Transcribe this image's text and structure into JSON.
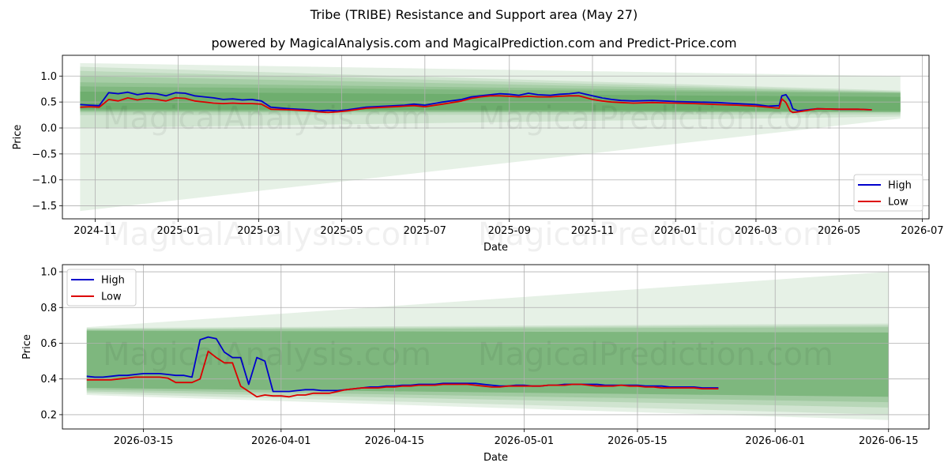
{
  "header": {
    "title": "Tribe (TRIBE) Resistance and Support area (May 27)",
    "subtitle": "powered by MagicalAnalysis.com and MagicalPrediction.com and Predict-Price.com"
  },
  "watermarks": [
    "MagicalAnalysis.com",
    "MagicalPrediction.com"
  ],
  "colors": {
    "high": "#0000cc",
    "low": "#dd0000",
    "band": "#2e8b2e",
    "grid": "#b0b0b0"
  },
  "chart_data": [
    {
      "type": "line",
      "xlabel": "Date",
      "ylabel": "Price",
      "xlim": [
        "2024-10-08",
        "2026-07-06"
      ],
      "ylim": [
        -1.75,
        1.4
      ],
      "x_ticks": [
        "2024-11-01",
        "2025-01-01",
        "2025-03-01",
        "2025-05-01",
        "2025-07-01",
        "2025-09-01",
        "2025-11-01",
        "2026-01-01",
        "2026-03-01",
        "2026-05-01",
        "2026-07-01"
      ],
      "x_tick_labels": [
        "2024-11",
        "2025-01",
        "2025-03",
        "2025-05",
        "2025-07",
        "2025-09",
        "2025-11",
        "2026-01",
        "2026-03",
        "2026-05",
        "2026-07"
      ],
      "y_ticks": [
        1.0,
        0.5,
        0.0,
        -0.5,
        -1.0,
        -1.5
      ],
      "y_tick_labels": [
        "1.0",
        "0.5",
        "0.0",
        "−0.5",
        "−1.0",
        "−1.5"
      ],
      "grid": true,
      "legend": {
        "position": "bottom-right",
        "entries": [
          "High",
          "Low"
        ]
      },
      "bands": {
        "x": [
          "2024-10-21",
          "2026-06-15"
        ],
        "layers": [
          {
            "lower": [
              -1.6,
              0.18
            ],
            "upper": [
              1.25,
              1.0
            ],
            "opacity": 0.12
          },
          {
            "lower": [
              0.0,
              0.22
            ],
            "upper": [
              1.18,
              0.72
            ],
            "opacity": 0.12
          },
          {
            "lower": [
              0.25,
              0.26
            ],
            "upper": [
              1.1,
              0.7
            ],
            "opacity": 0.12
          },
          {
            "lower": [
              0.3,
              0.3
            ],
            "upper": [
              1.0,
              0.69
            ],
            "opacity": 0.14
          },
          {
            "lower": [
              0.32,
              0.3
            ],
            "upper": [
              0.88,
              0.68
            ],
            "opacity": 0.16
          },
          {
            "lower": [
              0.34,
              0.31
            ],
            "upper": [
              0.8,
              0.67
            ],
            "opacity": 0.18
          },
          {
            "lower": [
              0.36,
              0.33
            ],
            "upper": [
              0.7,
              0.6
            ],
            "opacity": 0.22
          }
        ]
      },
      "series": [
        {
          "name": "High",
          "x": [
            "2024-10-21",
            "2024-10-28",
            "2024-11-04",
            "2024-11-11",
            "2024-11-18",
            "2024-11-25",
            "2024-12-02",
            "2024-12-09",
            "2024-12-16",
            "2024-12-23",
            "2024-12-30",
            "2025-01-06",
            "2025-01-13",
            "2025-01-20",
            "2025-01-27",
            "2025-02-03",
            "2025-02-10",
            "2025-02-17",
            "2025-02-24",
            "2025-03-03",
            "2025-03-10",
            "2025-03-24",
            "2025-04-07",
            "2025-04-14",
            "2025-04-21",
            "2025-04-28",
            "2025-05-05",
            "2025-05-19",
            "2025-06-02",
            "2025-06-16",
            "2025-06-23",
            "2025-07-01",
            "2025-07-14",
            "2025-07-28",
            "2025-08-04",
            "2025-08-11",
            "2025-08-18",
            "2025-08-25",
            "2025-09-01",
            "2025-09-08",
            "2025-09-15",
            "2025-09-22",
            "2025-10-01",
            "2025-10-08",
            "2025-10-15",
            "2025-10-22",
            "2025-11-01",
            "2025-11-08",
            "2025-11-15",
            "2025-11-22",
            "2025-12-01",
            "2025-12-15",
            "2026-01-01",
            "2026-01-15",
            "2026-02-01",
            "2026-02-15",
            "2026-03-01",
            "2026-03-10",
            "2026-03-18",
            "2026-03-20",
            "2026-03-23",
            "2026-03-26",
            "2026-03-28",
            "2026-04-01",
            "2026-04-15",
            "2026-05-01",
            "2026-05-15",
            "2026-05-25"
          ],
          "values": [
            0.45,
            0.44,
            0.43,
            0.68,
            0.66,
            0.69,
            0.64,
            0.67,
            0.66,
            0.62,
            0.68,
            0.67,
            0.62,
            0.6,
            0.58,
            0.55,
            0.56,
            0.54,
            0.55,
            0.52,
            0.4,
            0.37,
            0.35,
            0.33,
            0.34,
            0.33,
            0.35,
            0.4,
            0.42,
            0.44,
            0.46,
            0.44,
            0.5,
            0.55,
            0.6,
            0.62,
            0.64,
            0.66,
            0.65,
            0.63,
            0.67,
            0.64,
            0.63,
            0.65,
            0.66,
            0.68,
            0.62,
            0.58,
            0.55,
            0.53,
            0.52,
            0.53,
            0.51,
            0.5,
            0.49,
            0.47,
            0.45,
            0.42,
            0.43,
            0.62,
            0.64,
            0.52,
            0.37,
            0.33,
            0.37,
            0.36,
            0.36,
            0.35
          ]
        },
        {
          "name": "Low",
          "x": [
            "2024-10-21",
            "2024-10-28",
            "2024-11-04",
            "2024-11-11",
            "2024-11-18",
            "2024-11-25",
            "2024-12-02",
            "2024-12-09",
            "2024-12-16",
            "2024-12-23",
            "2024-12-30",
            "2025-01-06",
            "2025-01-13",
            "2025-01-20",
            "2025-01-27",
            "2025-02-03",
            "2025-02-10",
            "2025-02-17",
            "2025-02-24",
            "2025-03-03",
            "2025-03-10",
            "2025-03-24",
            "2025-04-07",
            "2025-04-14",
            "2025-04-21",
            "2025-04-28",
            "2025-05-05",
            "2025-05-19",
            "2025-06-02",
            "2025-06-16",
            "2025-06-23",
            "2025-07-01",
            "2025-07-14",
            "2025-07-28",
            "2025-08-04",
            "2025-08-11",
            "2025-08-18",
            "2025-08-25",
            "2025-09-01",
            "2025-09-08",
            "2025-09-15",
            "2025-09-22",
            "2025-10-01",
            "2025-10-08",
            "2025-10-15",
            "2025-10-22",
            "2025-11-01",
            "2025-11-08",
            "2025-11-15",
            "2025-11-22",
            "2025-12-01",
            "2025-12-15",
            "2026-01-01",
            "2026-01-15",
            "2026-02-01",
            "2026-02-15",
            "2026-03-01",
            "2026-03-10",
            "2026-03-18",
            "2026-03-20",
            "2026-03-23",
            "2026-03-26",
            "2026-03-28",
            "2026-04-01",
            "2026-04-15",
            "2026-05-01",
            "2026-05-15",
            "2026-05-25"
          ],
          "values": [
            0.4,
            0.41,
            0.4,
            0.55,
            0.52,
            0.58,
            0.54,
            0.57,
            0.55,
            0.52,
            0.58,
            0.57,
            0.52,
            0.5,
            0.48,
            0.47,
            0.48,
            0.47,
            0.47,
            0.46,
            0.36,
            0.35,
            0.33,
            0.31,
            0.3,
            0.31,
            0.33,
            0.38,
            0.4,
            0.42,
            0.43,
            0.41,
            0.46,
            0.52,
            0.57,
            0.6,
            0.62,
            0.62,
            0.61,
            0.6,
            0.61,
            0.6,
            0.6,
            0.61,
            0.62,
            0.62,
            0.55,
            0.52,
            0.5,
            0.49,
            0.48,
            0.49,
            0.48,
            0.47,
            0.45,
            0.44,
            0.42,
            0.4,
            0.38,
            0.56,
            0.49,
            0.33,
            0.3,
            0.31,
            0.37,
            0.36,
            0.36,
            0.35
          ]
        }
      ]
    },
    {
      "type": "line",
      "xlabel": "Date",
      "ylabel": "Price",
      "xlim": [
        "2026-03-05",
        "2026-06-20"
      ],
      "ylim": [
        0.12,
        1.04
      ],
      "x_ticks": [
        "2026-03-15",
        "2026-04-01",
        "2026-04-15",
        "2026-05-01",
        "2026-05-15",
        "2026-06-01",
        "2026-06-15"
      ],
      "x_tick_labels": [
        "2026-03-15",
        "2026-04-01",
        "2026-04-15",
        "2026-05-01",
        "2026-05-15",
        "2026-06-01",
        "2026-06-15"
      ],
      "y_ticks": [
        1.0,
        0.8,
        0.6,
        0.4,
        0.2
      ],
      "y_tick_labels": [
        "1.0",
        "0.8",
        "0.6",
        "0.4",
        "0.2"
      ],
      "grid": true,
      "legend": {
        "position": "top-left",
        "entries": [
          "High",
          "Low"
        ]
      },
      "bands": {
        "x": [
          "2026-03-08",
          "2026-06-15"
        ],
        "layers": [
          {
            "lower": [
              0.31,
              0.17
            ],
            "upper": [
              0.69,
              1.0
            ],
            "opacity": 0.12
          },
          {
            "lower": [
              0.32,
              0.2
            ],
            "upper": [
              0.685,
              0.71
            ],
            "opacity": 0.12
          },
          {
            "lower": [
              0.33,
              0.24
            ],
            "upper": [
              0.68,
              0.7
            ],
            "opacity": 0.14
          },
          {
            "lower": [
              0.34,
              0.27
            ],
            "upper": [
              0.675,
              0.69
            ],
            "opacity": 0.16
          },
          {
            "lower": [
              0.35,
              0.3
            ],
            "upper": [
              0.67,
              0.66
            ],
            "opacity": 0.3
          }
        ]
      },
      "series": [
        {
          "name": "High",
          "x": [
            "2026-03-08",
            "2026-03-09",
            "2026-03-10",
            "2026-03-11",
            "2026-03-12",
            "2026-03-13",
            "2026-03-14",
            "2026-03-15",
            "2026-03-16",
            "2026-03-17",
            "2026-03-18",
            "2026-03-19",
            "2026-03-20",
            "2026-03-21",
            "2026-03-22",
            "2026-03-23",
            "2026-03-24",
            "2026-03-25",
            "2026-03-26",
            "2026-03-27",
            "2026-03-28",
            "2026-03-29",
            "2026-03-30",
            "2026-03-31",
            "2026-04-01",
            "2026-04-02",
            "2026-04-03",
            "2026-04-04",
            "2026-04-05",
            "2026-04-06",
            "2026-04-07",
            "2026-04-08",
            "2026-04-09",
            "2026-04-10",
            "2026-04-11",
            "2026-04-12",
            "2026-04-13",
            "2026-04-14",
            "2026-04-15",
            "2026-04-16",
            "2026-04-17",
            "2026-04-18",
            "2026-04-19",
            "2026-04-20",
            "2026-04-21",
            "2026-04-22",
            "2026-04-23",
            "2026-04-24",
            "2026-04-25",
            "2026-04-26",
            "2026-04-27",
            "2026-04-28",
            "2026-04-29",
            "2026-04-30",
            "2026-05-01",
            "2026-05-02",
            "2026-05-03",
            "2026-05-04",
            "2026-05-05",
            "2026-05-06",
            "2026-05-07",
            "2026-05-08",
            "2026-05-09",
            "2026-05-10",
            "2026-05-11",
            "2026-05-12",
            "2026-05-13",
            "2026-05-14",
            "2026-05-15",
            "2026-05-16",
            "2026-05-17",
            "2026-05-18",
            "2026-05-19",
            "2026-05-20",
            "2026-05-21",
            "2026-05-22",
            "2026-05-23",
            "2026-05-24",
            "2026-05-25"
          ],
          "values": [
            0.415,
            0.41,
            0.41,
            0.415,
            0.42,
            0.42,
            0.425,
            0.43,
            0.43,
            0.43,
            0.425,
            0.42,
            0.42,
            0.41,
            0.62,
            0.635,
            0.625,
            0.55,
            0.52,
            0.52,
            0.37,
            0.52,
            0.5,
            0.33,
            0.33,
            0.33,
            0.335,
            0.34,
            0.34,
            0.335,
            0.335,
            0.335,
            0.34,
            0.345,
            0.35,
            0.355,
            0.355,
            0.36,
            0.36,
            0.365,
            0.365,
            0.37,
            0.37,
            0.37,
            0.375,
            0.375,
            0.375,
            0.375,
            0.375,
            0.37,
            0.365,
            0.36,
            0.36,
            0.365,
            0.365,
            0.36,
            0.36,
            0.365,
            0.365,
            0.37,
            0.37,
            0.37,
            0.37,
            0.37,
            0.365,
            0.365,
            0.365,
            0.365,
            0.365,
            0.36,
            0.36,
            0.36,
            0.355,
            0.355,
            0.355,
            0.355,
            0.35,
            0.35,
            0.35
          ]
        },
        {
          "name": "Low",
          "x": [
            "2026-03-08",
            "2026-03-09",
            "2026-03-10",
            "2026-03-11",
            "2026-03-12",
            "2026-03-13",
            "2026-03-14",
            "2026-03-15",
            "2026-03-16",
            "2026-03-17",
            "2026-03-18",
            "2026-03-19",
            "2026-03-20",
            "2026-03-21",
            "2026-03-22",
            "2026-03-23",
            "2026-03-24",
            "2026-03-25",
            "2026-03-26",
            "2026-03-27",
            "2026-03-28",
            "2026-03-29",
            "2026-03-30",
            "2026-03-31",
            "2026-04-01",
            "2026-04-02",
            "2026-04-03",
            "2026-04-04",
            "2026-04-05",
            "2026-04-06",
            "2026-04-07",
            "2026-04-08",
            "2026-04-09",
            "2026-04-10",
            "2026-04-11",
            "2026-04-12",
            "2026-04-13",
            "2026-04-14",
            "2026-04-15",
            "2026-04-16",
            "2026-04-17",
            "2026-04-18",
            "2026-04-19",
            "2026-04-20",
            "2026-04-21",
            "2026-04-22",
            "2026-04-23",
            "2026-04-24",
            "2026-04-25",
            "2026-04-26",
            "2026-04-27",
            "2026-04-28",
            "2026-04-29",
            "2026-04-30",
            "2026-05-01",
            "2026-05-02",
            "2026-05-03",
            "2026-05-04",
            "2026-05-05",
            "2026-05-06",
            "2026-05-07",
            "2026-05-08",
            "2026-05-09",
            "2026-05-10",
            "2026-05-11",
            "2026-05-12",
            "2026-05-13",
            "2026-05-14",
            "2026-05-15",
            "2026-05-16",
            "2026-05-17",
            "2026-05-18",
            "2026-05-19",
            "2026-05-20",
            "2026-05-21",
            "2026-05-22",
            "2026-05-23",
            "2026-05-24",
            "2026-05-25"
          ],
          "values": [
            0.395,
            0.395,
            0.395,
            0.395,
            0.4,
            0.405,
            0.41,
            0.41,
            0.41,
            0.41,
            0.405,
            0.38,
            0.38,
            0.38,
            0.4,
            0.555,
            0.52,
            0.49,
            0.49,
            0.36,
            0.33,
            0.3,
            0.31,
            0.305,
            0.305,
            0.3,
            0.31,
            0.31,
            0.32,
            0.32,
            0.32,
            0.33,
            0.34,
            0.345,
            0.35,
            0.35,
            0.35,
            0.355,
            0.355,
            0.36,
            0.36,
            0.365,
            0.365,
            0.365,
            0.37,
            0.37,
            0.37,
            0.37,
            0.365,
            0.36,
            0.355,
            0.355,
            0.36,
            0.36,
            0.36,
            0.36,
            0.36,
            0.365,
            0.365,
            0.365,
            0.37,
            0.37,
            0.365,
            0.36,
            0.36,
            0.36,
            0.365,
            0.36,
            0.36,
            0.355,
            0.355,
            0.35,
            0.35,
            0.35,
            0.35,
            0.35,
            0.345,
            0.345,
            0.345
          ]
        }
      ]
    }
  ]
}
